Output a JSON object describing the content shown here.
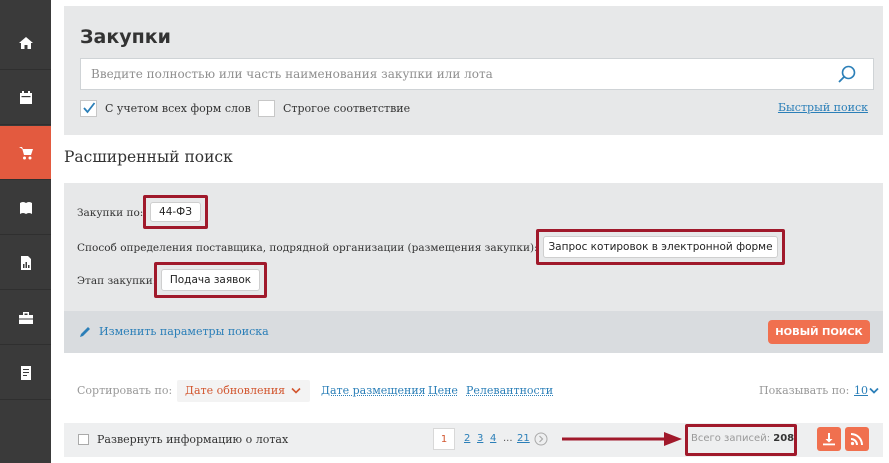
{
  "sidebar": {
    "items": [
      {
        "icon": "home-icon",
        "active": false
      },
      {
        "icon": "calendar-icon",
        "active": false
      },
      {
        "icon": "cart-icon",
        "active": true
      },
      {
        "icon": "book-icon",
        "active": false
      },
      {
        "icon": "report-icon",
        "active": false
      },
      {
        "icon": "briefcase-icon",
        "active": false
      },
      {
        "icon": "document-icon",
        "active": false
      }
    ]
  },
  "search": {
    "title": "Закупки",
    "placeholder": "Введите полностью или часть наименования закупки или лота",
    "value": "",
    "all_word_forms_label": "С учетом всех форм слов",
    "all_word_forms_checked": true,
    "strict_match_label": "Строгое соответствие",
    "strict_match_checked": false,
    "quick_search_label": "Быстрый поиск"
  },
  "advanced": {
    "title": "Расширенный поиск",
    "procurement_by_label": "Закупки по:",
    "procurement_by_value": "44-ФЗ",
    "method_label": "Способ определения поставщика, подрядной организации (размещения закупки):",
    "method_value": "Запрос котировок в электронной форме",
    "stage_label": "Этап закупки:",
    "stage_value": "Подача заявок",
    "edit_params_label": "Изменить параметры поиска",
    "new_search_label": "НОВЫЙ ПОИСК"
  },
  "sort": {
    "label": "Сортировать по:",
    "selected": "Дате обновления",
    "options": [
      "Дате размещения",
      "Цене",
      "Релевантности"
    ],
    "show_label": "Показывать по:",
    "show_value": "10"
  },
  "results": {
    "expand_lots_label": "Развернуть информацию о лотах",
    "current_page": "1",
    "pages": [
      "2",
      "3",
      "4"
    ],
    "ellipsis": "...",
    "last_page": "21",
    "total_label": "Всего записей:",
    "total_value": "208"
  },
  "colors": {
    "accent": "#f0704f",
    "sidebar_bg": "#3a3a3a",
    "sidebar_active": "#e35a3f",
    "highlight_border": "#a0192b",
    "link": "#2b7fb8",
    "panel_bg": "#e7e8e9"
  }
}
